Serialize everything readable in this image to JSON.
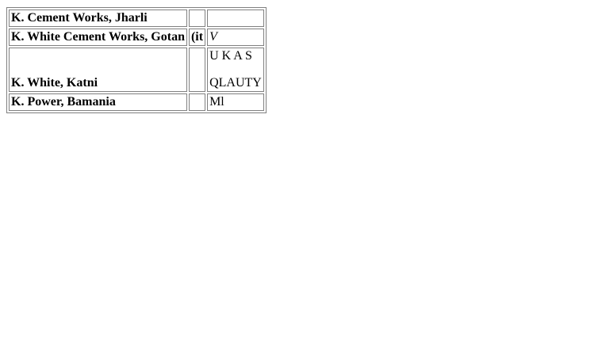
{
  "table": {
    "rows": [
      {
        "name": "K. Cement Works, Jharli",
        "mark": "",
        "note": ""
      },
      {
        "name": "K. White Cement Works, Gotan",
        "mark": "(it",
        "note": "V"
      },
      {
        "name": "K. White, Katni",
        "mark": "",
        "note_top": "U K A S",
        "note_bottom": "QLAUTY"
      },
      {
        "name": "K. Power, Bamania",
        "mark": "",
        "note": "Ml"
      }
    ]
  }
}
